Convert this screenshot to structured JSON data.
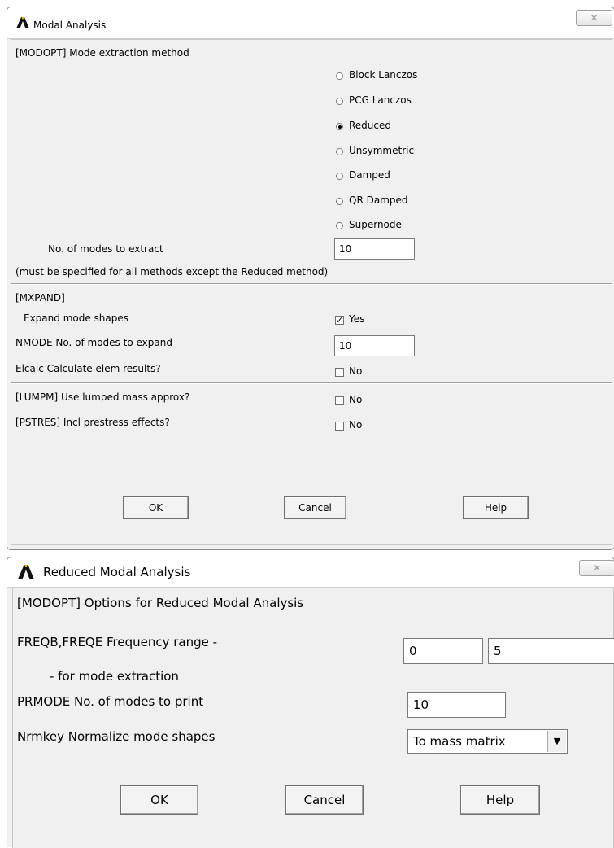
{
  "dialog1": {
    "title": "Modal Analysis",
    "close_glyph": "✕",
    "method_header": "[MODOPT] Mode extraction method",
    "methods": [
      {
        "label": "Block Lanczos",
        "selected": false
      },
      {
        "label": "PCG Lanczos",
        "selected": false
      },
      {
        "label": "Reduced",
        "selected": true
      },
      {
        "label": "Unsymmetric",
        "selected": false
      },
      {
        "label": "Damped",
        "selected": false
      },
      {
        "label": "QR Damped",
        "selected": false
      },
      {
        "label": "Supernode",
        "selected": false
      }
    ],
    "modes_label": "No. of modes to extract",
    "modes_value": "10",
    "modes_note": "(must be specified for all methods except the Reduced method)",
    "mxpand_header": "[MXPAND]",
    "expand_label": "Expand mode shapes",
    "expand_checked": true,
    "expand_value": "Yes",
    "nmode_label": "NMODE No. of modes to expand",
    "nmode_value": "10",
    "elcalc_label": "Elcalc  Calculate elem results?",
    "elcalc_value": "No",
    "lumpm_label": "[LUMPM]  Use lumped mass approx?",
    "lumpm_value": "No",
    "pstres_label": "[PSTRES] Incl prestress effects?",
    "pstres_value": "No",
    "ok_label": "OK",
    "cancel_label": "Cancel",
    "help_label": "Help"
  },
  "dialog2": {
    "title": "Reduced Modal Analysis",
    "close_glyph": "✕",
    "header": "[MODOPT]  Options for Reduced Modal Analysis",
    "freq_label": "FREQB,FREQE  Frequency range -",
    "freq_sub": "- for mode extraction",
    "freqb_value": "0",
    "freqe_value": "5",
    "prmode_label": "PRMODE   No. of modes to print",
    "prmode_value": "10",
    "nrmkey_label": "Nrmkey   Normalize mode shapes",
    "nrmkey_value": "To mass matrix",
    "arrow_glyph": "▼",
    "ok_label": "OK",
    "cancel_label": "Cancel",
    "help_label": "Help"
  }
}
